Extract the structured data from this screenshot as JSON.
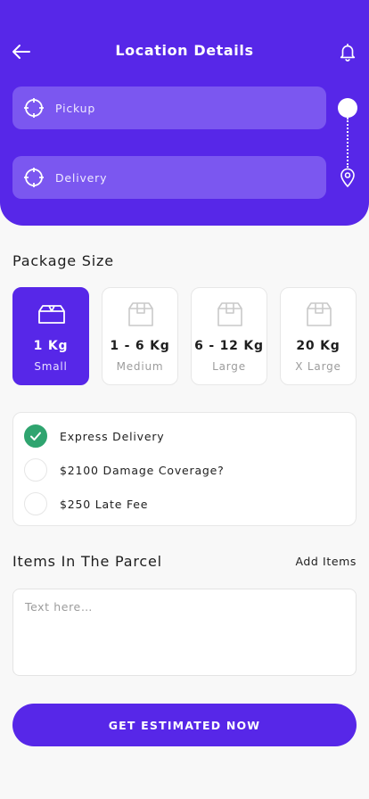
{
  "header": {
    "title": "Location Details",
    "back_icon": "arrow-left-icon",
    "notification_icon": "bell-icon",
    "background": "#5727e8"
  },
  "locations": {
    "pickup": {
      "label": "Pickup",
      "icon": "crosshair-icon"
    },
    "delivery": {
      "label": "Delivery",
      "icon": "crosshair-icon"
    },
    "route_end_icon": "map-pin-icon"
  },
  "package_size": {
    "title": "Package Size",
    "selected_index": 0,
    "options": [
      {
        "weight": "1 Kg",
        "size": "Small",
        "icon": "box-icon"
      },
      {
        "weight": "1 - 6 Kg",
        "size": "Medium",
        "icon": "box-icon"
      },
      {
        "weight": "6 - 12 Kg",
        "size": "Large",
        "icon": "box-icon"
      },
      {
        "weight": "20 Kg",
        "size": "X Large",
        "icon": "box-icon"
      }
    ]
  },
  "options": [
    {
      "label": "Express Delivery",
      "checked": true
    },
    {
      "label": "$2100 Damage Coverage?",
      "checked": false
    },
    {
      "label": "$250 Late Fee",
      "checked": false
    }
  ],
  "items": {
    "title": "Items In The Parcel",
    "add_label": "Add Items",
    "placeholder": "Text here…",
    "value": ""
  },
  "cta": {
    "label": "GET ESTIMATED NOW"
  },
  "colors": {
    "accent": "#5727e8",
    "field": "#7b57f0",
    "check": "#2fa46f"
  }
}
